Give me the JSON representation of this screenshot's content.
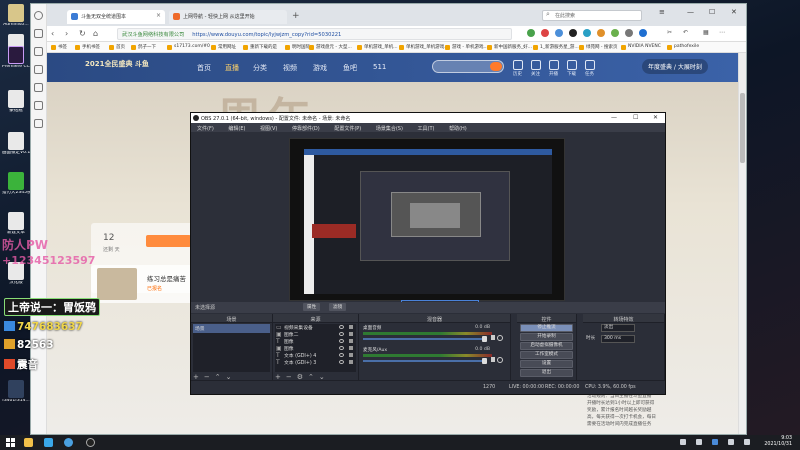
{
  "desktop": {
    "icons": [
      {
        "label": "Administr..."
      },
      {
        "label": ""
      },
      {
        "label": "Premiere CC2019"
      },
      {
        "label": "豪钻瓶"
      },
      {
        "label": "画面锁定V0.1"
      },
      {
        "label": "猎刃大2345视频"
      },
      {
        "label": "新建文本"
      },
      {
        "label": "汉化版"
      },
      {
        "label": "f3401f314..."
      }
    ]
  },
  "browser": {
    "tabs": [
      {
        "label": "斗鱼无双全统道围本"
      },
      {
        "label": "上网导航 - 轻快上网 从这里开始"
      }
    ],
    "search_box": "在此搜索",
    "address": {
      "site": "武汉斗鱼网络科技有限公司",
      "url": "https://www.douyu.com/topic/lyjwjzm_copy?rid=5030221"
    },
    "bookmarks": [
      "书签",
      "手机书签",
      "首页",
      "鸽子一下",
      "s17173.com/#0",
      "常用网址",
      "重新下载的是",
      "明时国际",
      "游戏盘元 - 大型...",
      "单机游戏_单机...",
      "单机游戏_单机游戏...",
      "游戏 - 单机游戏...",
      "新中国新服务_好...",
      "1_新游服务星_游...",
      "绿苑网 - 搜索页",
      "NVIDIA NVENC",
      "pathofexile",
      "pathofexile中文"
    ]
  },
  "douyu": {
    "logo": "2021全民盛典 斗鱼",
    "nav": [
      "首页",
      "直播",
      "分类",
      "视频",
      "游戏",
      "鱼吧",
      "511"
    ],
    "header_icons": [
      "历史",
      "关注",
      "开播",
      "下载",
      "任务"
    ],
    "banner": "年度盛典 / 大展时刻",
    "hero": "周年",
    "card_num": "12",
    "card_days": "还剩 天",
    "card2_title": "练习总是痛苦",
    "card2_sub": "已报名",
    "text_lines": [
      "活动规则：当日主播在斗鱼直播",
      "开播时长达到1小时以上即可获得",
      "奖励，累计报名时间越长奖励越",
      "高，每天获得一次打卡机会，每日",
      "需要在活动时间内完成直播任务"
    ]
  },
  "obs": {
    "title": "OBS 27.0.1 (64-bit, windows) - 配置文件: 未命名 - 场景: 未命名",
    "menu": [
      "文件(F)",
      "编辑(E)",
      "视图(V)",
      "停靠部件(D)",
      "配置文件(P)",
      "场景集合(S)",
      "工具(T)",
      "帮助(H)"
    ],
    "context_label": "未选择源",
    "context_buttons": [
      "属性",
      "滤镜"
    ],
    "dock_scenes": {
      "title": "场景",
      "items": [
        "场景"
      ]
    },
    "dock_sources": {
      "title": "来源",
      "items": [
        {
          "label": "视频采集设备"
        },
        {
          "label": "图像二"
        },
        {
          "label": "图像"
        },
        {
          "label": "图像"
        },
        {
          "label": "文本 (GDI+) 4"
        },
        {
          "label": "文本 (GDI+) 3"
        }
      ]
    },
    "dock_mixer": {
      "title": "混音器",
      "tracks": [
        {
          "name": "桌面音频",
          "db": "0.0 dB"
        },
        {
          "name": "麦克风/Aux",
          "db": "0.0 dB"
        }
      ]
    },
    "dock_controls": {
      "title": "控件",
      "buttons": [
        "停止推流",
        "开始录制",
        "启动虚拟摄像机",
        "工作室模式",
        "设置",
        "退出"
      ]
    },
    "dock_transitions": {
      "title": "转场特效",
      "type": "淡出",
      "duration_label": "时长",
      "duration": "300 ms"
    },
    "status": {
      "live": "LIVE: 00:00:00",
      "rec": "REC: 00:00:00",
      "cpu": "CPU: 3.9%, 60.00 fps",
      "kb": "1270"
    }
  },
  "overlays": {
    "line1": "防人PW",
    "line2": "+12345123597",
    "line3": "上帝说一：胃饭鸦",
    "line4": "747683637",
    "line5": "82563",
    "line6": "震音"
  },
  "taskbar": {
    "time": "9:03",
    "date": "2021/10/31"
  },
  "colors": {
    "obs_bg": "#2b2e38",
    "douyu_blue": "#2b4a83",
    "overlay_pink": "#e65aa6",
    "stop_stream": "#7a8fb8"
  }
}
